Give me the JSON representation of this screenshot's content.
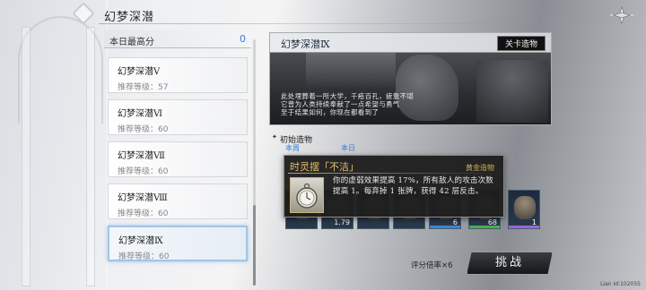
{
  "header": {
    "title": "幻梦深潜"
  },
  "best_score": {
    "label": "本日最高分",
    "value": "0"
  },
  "stages": [
    {
      "name": "幻梦深潜Ⅴ",
      "recommended": "推荐等级：57"
    },
    {
      "name": "幻梦深潜Ⅵ",
      "recommended": "推荐等级：60"
    },
    {
      "name": "幻梦深潜Ⅶ",
      "recommended": "推荐等级：60"
    },
    {
      "name": "幻梦深潜Ⅷ",
      "recommended": "推荐等级：60"
    },
    {
      "name": "幻梦深潜Ⅸ",
      "recommended": "推荐等级：60",
      "selected": true
    }
  ],
  "stage_card": {
    "title": "幻梦深潜Ⅸ",
    "tag": "关卡造物",
    "description": "此处埋葬着一所大学，千疮百孔，疲惫不堪\n它曾为人类持续奉献了一点希望与勇气\n至于结果如何，你现在都看到了"
  },
  "initial": {
    "label": "初始造物",
    "week": "本周",
    "today": "本日"
  },
  "tooltip": {
    "title": "时灵摆「不洁」",
    "rarity": "黄金造物",
    "description": "你的虚弱效果提高 17%，所有敌人的攻击次数提高 1。每弃掉 1 张牌，获得 42 层反击。"
  },
  "slots": [
    {
      "count": ""
    },
    {
      "count": "1.79"
    },
    {
      "count": ""
    },
    {
      "count": ""
    },
    {
      "count": "6"
    },
    {
      "count": "68"
    },
    {
      "count": "1"
    }
  ],
  "footer": {
    "rate": "评分倍率×6",
    "challenge": "挑战",
    "uid": "Lian Id:102055"
  }
}
